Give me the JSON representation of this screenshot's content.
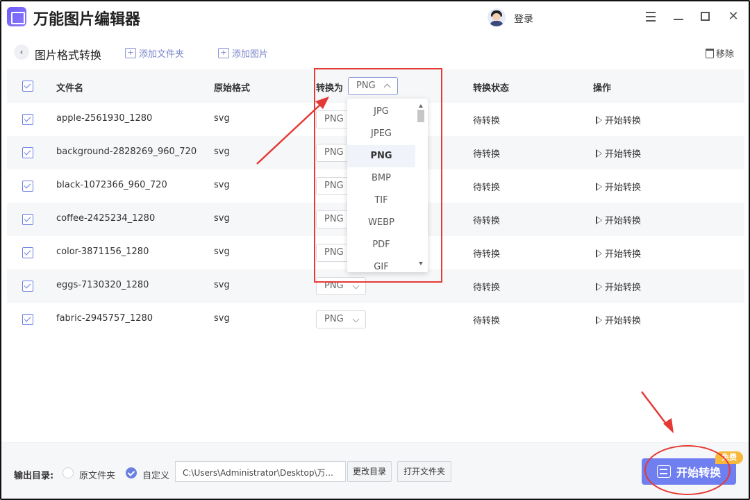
{
  "app": {
    "title": "万能图片编辑器",
    "login_label": "登录"
  },
  "toolbar": {
    "back_label": "‹",
    "page_title": "图片格式转换",
    "add_folder_label": "添加文件夹",
    "add_image_label": "添加图片",
    "remove_label": "移除"
  },
  "table": {
    "columns": {
      "filename": "文件名",
      "original_format": "原始格式",
      "convert_to": "转换为",
      "status": "转换状态",
      "action": "操作"
    },
    "header_select_value": "PNG",
    "rows": [
      {
        "filename": "apple-2561930_1280",
        "format": "svg",
        "target": "PNG",
        "status": "待转换",
        "action": "开始转换"
      },
      {
        "filename": "background-2828269_960_720",
        "format": "svg",
        "target": "PNG",
        "status": "待转换",
        "action": "开始转换"
      },
      {
        "filename": "black-1072366_960_720",
        "format": "svg",
        "target": "PNG",
        "status": "待转换",
        "action": "开始转换"
      },
      {
        "filename": "coffee-2425234_1280",
        "format": "svg",
        "target": "PNG",
        "status": "待转换",
        "action": "开始转换"
      },
      {
        "filename": "color-3871156_1280",
        "format": "svg",
        "target": "PNG",
        "status": "待转换",
        "action": "开始转换"
      },
      {
        "filename": "eggs-7130320_1280",
        "format": "svg",
        "target": "PNG",
        "status": "待转换",
        "action": "开始转换"
      },
      {
        "filename": "fabric-2945757_1280",
        "format": "svg",
        "target": "PNG",
        "status": "待转换",
        "action": "开始转换"
      }
    ]
  },
  "dropdown": {
    "options": [
      "JPG",
      "JPEG",
      "PNG",
      "BMP",
      "TIF",
      "WEBP",
      "PDF",
      "GIF"
    ],
    "selected": "PNG"
  },
  "bottom": {
    "output_label": "输出目录:",
    "radio_original_label": "原文件夹",
    "radio_custom_label": "自定义",
    "selected_option": "自定义",
    "path_value": "C:\\Users\\Administrator\\Desktop\\万...",
    "change_dir_label": "更改目录",
    "open_folder_label": "打开文件夹",
    "start_label": "开始转换",
    "free_badge": "免费"
  },
  "colors": {
    "accent": "#6f7ff0",
    "annotation_red": "#e53935",
    "badge": "#f7b93c"
  },
  "icons": [
    "app-logo-icon",
    "avatar-icon",
    "menu-icon",
    "minimize-icon",
    "maximize-icon",
    "close-icon",
    "back-icon",
    "add-folder-icon",
    "add-image-icon",
    "trash-icon",
    "checkbox-icon",
    "play-icon",
    "chevron-down-icon",
    "chevron-up-icon",
    "swap-icon"
  ]
}
